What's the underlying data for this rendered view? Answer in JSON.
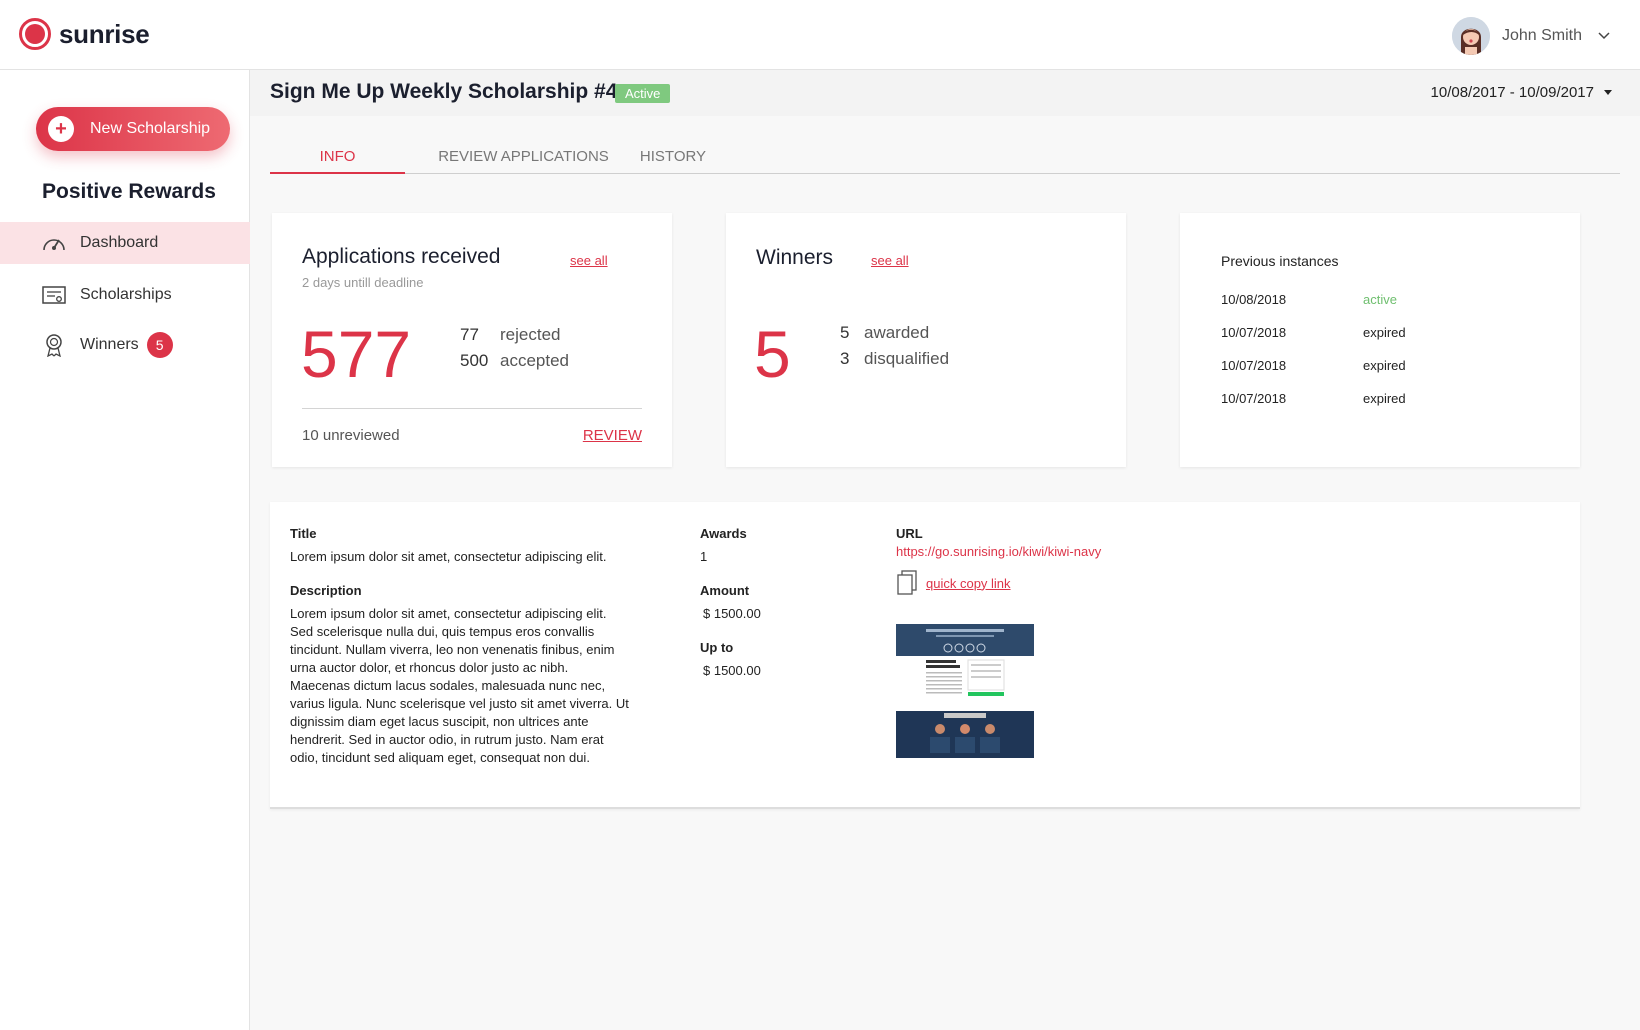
{
  "app": {
    "logo_text": "sunrise",
    "brand_color": "#dc3448",
    "user_name": "John Smith"
  },
  "sidebar": {
    "new_button_label": "New Scholarship",
    "org_title": "Positive Rewards",
    "items": [
      {
        "label": "Dashboard",
        "icon": "speedometer-icon",
        "active": true
      },
      {
        "label": "Scholarships",
        "icon": "certificate-icon",
        "active": false
      },
      {
        "label": "Winners",
        "icon": "award-ribbon-icon",
        "badge": "5",
        "active": false
      }
    ]
  },
  "header": {
    "title": "Sign Me Up Weekly Scholarship #4",
    "status": "Active",
    "date_range": "10/08/2017 - 10/09/2017"
  },
  "tabs": [
    "INFO",
    "REVIEW APPLICATIONS",
    "HISTORY"
  ],
  "applications": {
    "title": "Applications received",
    "see_all": "see all",
    "deadline_note": "2 days untill deadline",
    "total": "577",
    "rejected_count": "77",
    "rejected_label": "rejected",
    "accepted_count": "500",
    "accepted_label": "accepted",
    "unreviewed": "10 unreviewed",
    "review_link": "REVIEW"
  },
  "winners": {
    "title": "Winners",
    "see_all": "see all",
    "total": "5",
    "awarded_count": "5",
    "awarded_label": "awarded",
    "disqualified_count": "3",
    "disqualified_label": "disqualified"
  },
  "previous_instances": {
    "title": "Previous instances",
    "rows": [
      {
        "date": "10/08/2018",
        "status": "active"
      },
      {
        "date": "10/07/2018",
        "status": "expired"
      },
      {
        "date": "10/07/2018",
        "status": "expired"
      },
      {
        "date": "10/07/2018",
        "status": "expired"
      }
    ]
  },
  "details": {
    "title_label": "Title",
    "title_value": "Lorem ipsum dolor sit amet, consectetur adipiscing elit.",
    "description_label": "Description",
    "description_lines": [
      "Lorem ipsum dolor sit amet, consectetur adipiscing elit.",
      "Sed scelerisque nulla dui, quis tempus eros convallis",
      "tincidunt. Nullam viverra, leo non venenatis finibus, enim",
      "urna auctor dolor, et rhoncus dolor justo ac nibh.",
      "Maecenas dictum lacus sodales, malesuada nunc nec,",
      "varius ligula. Nunc scelerisque vel justo sit amet viverra. Ut",
      "dignissim diam eget lacus suscipit, non ultrices ante",
      "hendrerit. Sed in auctor odio, in rutrum justo. Nam erat",
      "odio, tincidunt sed aliquam eget, consequat non dui."
    ],
    "awards_label": "Awards",
    "awards_value": "1",
    "amount_label": "Amount",
    "amount_value": "$ 1500.00",
    "upto_label": "Up to",
    "upto_value": "$ 1500.00",
    "url_label": "URL",
    "url_value": "https://go.sunrising.io/kiwi/kiwi-navy",
    "copy_label": "quick copy link"
  }
}
